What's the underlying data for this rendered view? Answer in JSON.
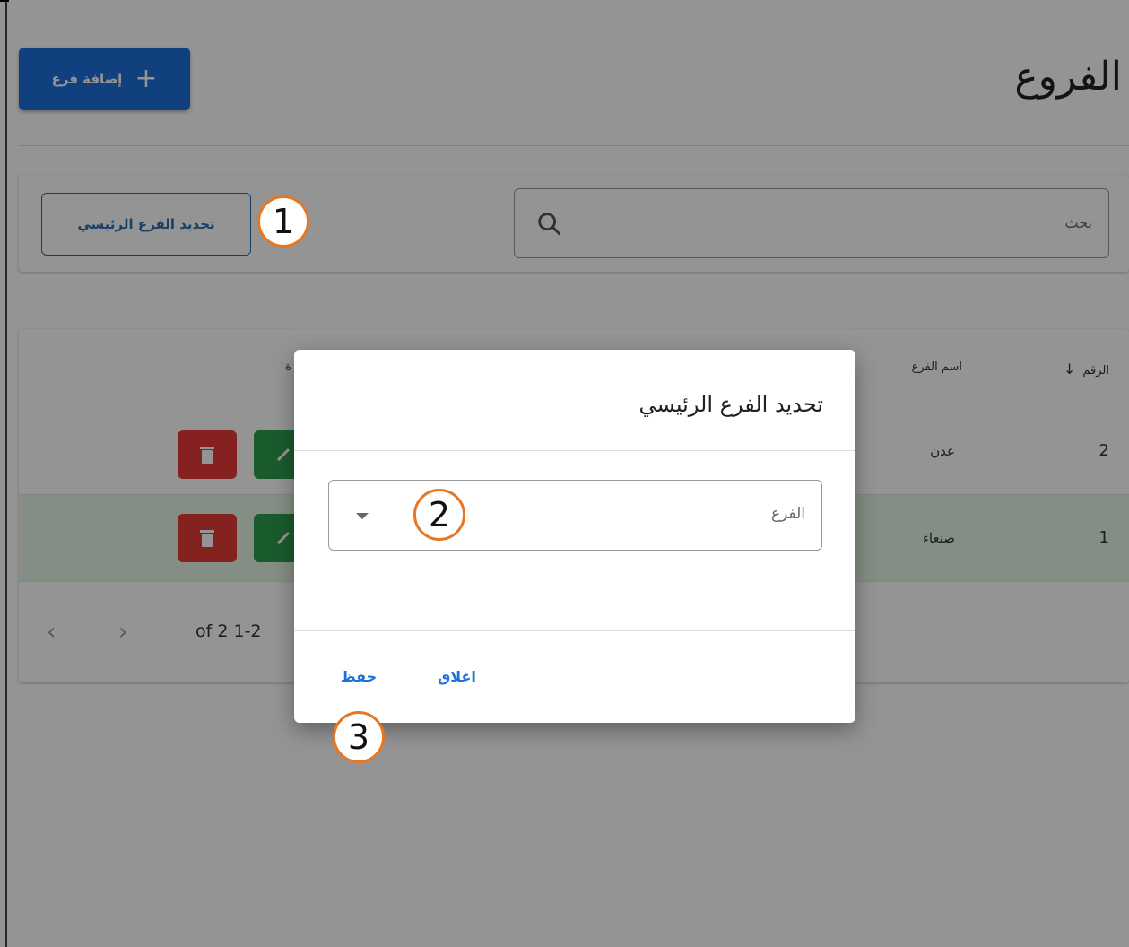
{
  "header": {
    "title": "الفروع",
    "add_button_label": "إضافة فرع",
    "add_button_icon": "plus-icon"
  },
  "filters": {
    "set_main_branch_label": "تحديد الفرع الرئيسي",
    "search_placeholder": "بحث"
  },
  "table": {
    "columns": {
      "number": "الرقم",
      "branch_name": "اسم الفرع",
      "actions": "ة"
    },
    "rows": [
      {
        "number": "2",
        "name": "عدن"
      },
      {
        "number": "1",
        "name": "صنعاء"
      }
    ],
    "pagination": "of 2 1-2"
  },
  "dialog": {
    "title": "تحديد الفرع الرئيسي",
    "select_label": "الفرع",
    "save_label": "حفظ",
    "close_label": "اغلاق"
  },
  "callouts": [
    "1",
    "2",
    "3"
  ],
  "colors": {
    "primary": "#1e6fd9",
    "delete": "#e53935",
    "edit": "#2e9e50",
    "callout_border": "#e87722"
  }
}
